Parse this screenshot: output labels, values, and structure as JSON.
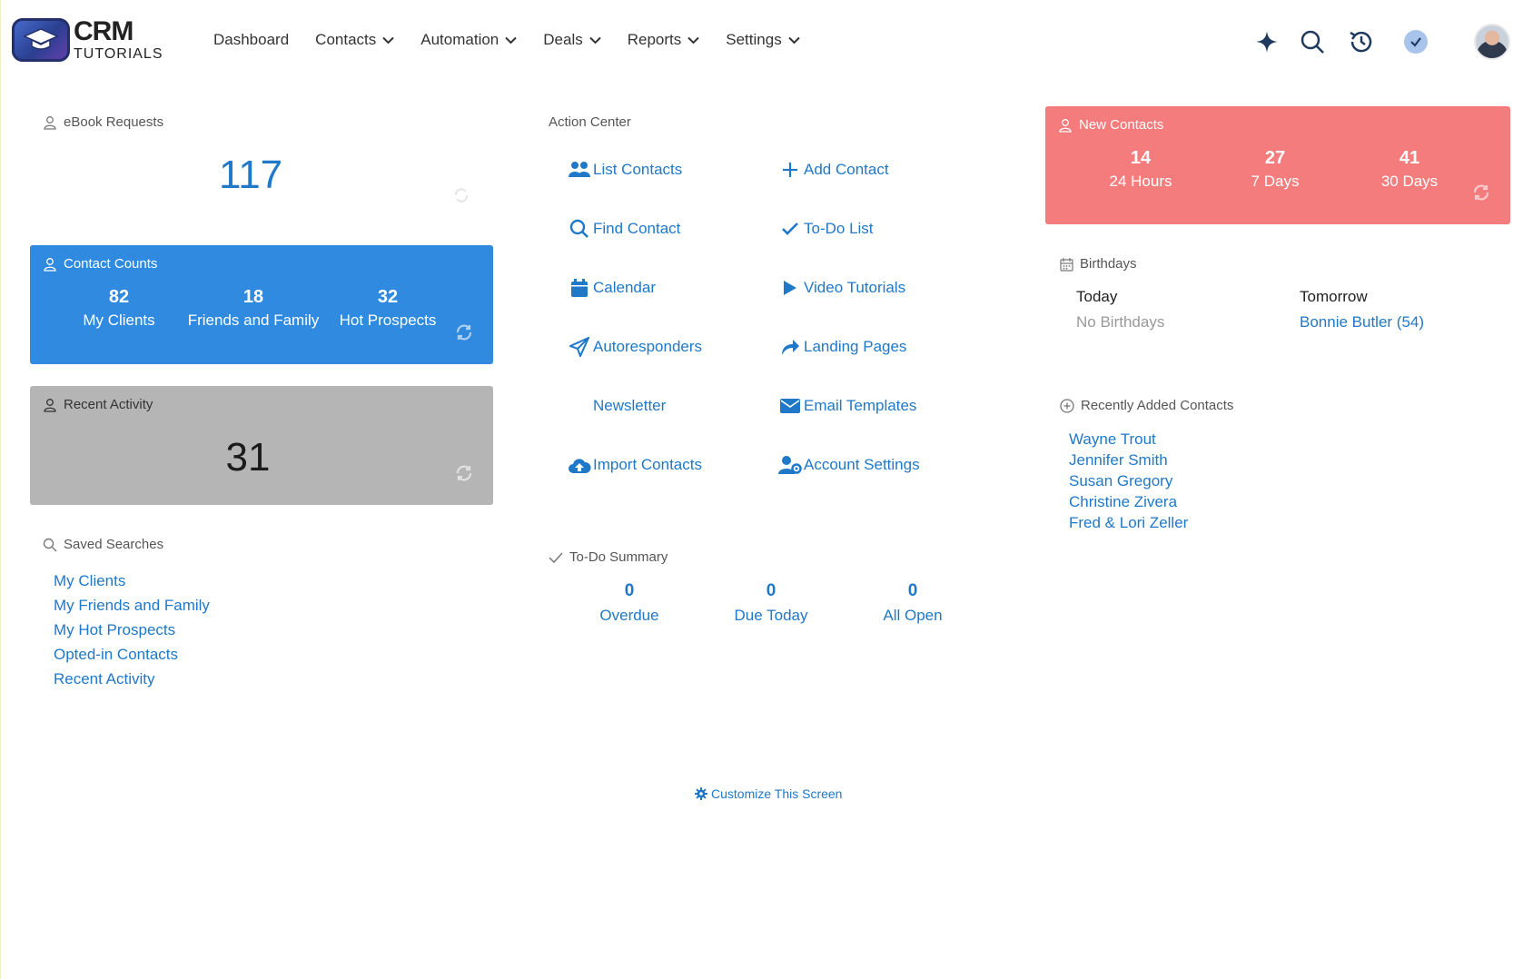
{
  "brand": {
    "line1": "CRM",
    "line2": "TUTORIALS"
  },
  "nav": {
    "items": [
      {
        "label": "Dashboard",
        "dropdown": false
      },
      {
        "label": "Contacts",
        "dropdown": true
      },
      {
        "label": "Automation",
        "dropdown": true
      },
      {
        "label": "Deals",
        "dropdown": true
      },
      {
        "label": "Reports",
        "dropdown": true
      },
      {
        "label": "Settings",
        "dropdown": true
      }
    ],
    "tools": [
      "sparkle-icon",
      "search-icon",
      "history-icon",
      "check-circle-icon"
    ]
  },
  "ebook": {
    "title": "eBook Requests",
    "count": "117"
  },
  "contact_counts": {
    "title": "Contact Counts",
    "stats": [
      {
        "num": "82",
        "label": "My Clients"
      },
      {
        "num": "18",
        "label": "Friends and Family"
      },
      {
        "num": "32",
        "label": "Hot Prospects"
      }
    ]
  },
  "recent_activity": {
    "title": "Recent Activity",
    "count": "31"
  },
  "saved_searches": {
    "title": "Saved Searches",
    "items": [
      "My Clients",
      "My Friends and Family",
      "My Hot Prospects",
      "Opted-in Contacts",
      "Recent Activity"
    ]
  },
  "action_center": {
    "title": "Action Center",
    "left": [
      {
        "label": "List Contacts",
        "icon": "users-icon"
      },
      {
        "label": "Find Contact",
        "icon": "search-icon"
      },
      {
        "label": "Calendar",
        "icon": "calendar-icon"
      },
      {
        "label": "Autoresponders",
        "icon": "paper-plane-icon"
      },
      {
        "label": "Newsletter",
        "icon": ""
      },
      {
        "label": "Import Contacts",
        "icon": "cloud-upload-icon"
      }
    ],
    "right": [
      {
        "label": "Add Contact",
        "icon": "plus-icon"
      },
      {
        "label": "To-Do List",
        "icon": "check-icon"
      },
      {
        "label": "Video Tutorials",
        "icon": "play-icon"
      },
      {
        "label": "Landing Pages",
        "icon": "share-arrow-icon"
      },
      {
        "label": "Email Templates",
        "icon": "envelope-icon"
      },
      {
        "label": "Account Settings",
        "icon": "user-gear-icon"
      }
    ]
  },
  "todo_summary": {
    "title": "To-Do Summary",
    "stats": [
      {
        "num": "0",
        "label": "Overdue"
      },
      {
        "num": "0",
        "label": "Due Today"
      },
      {
        "num": "0",
        "label": "All Open"
      }
    ]
  },
  "new_contacts": {
    "title": "New Contacts",
    "stats": [
      {
        "num": "14",
        "label": "24 Hours"
      },
      {
        "num": "27",
        "label": "7 Days"
      },
      {
        "num": "41",
        "label": "30 Days"
      }
    ]
  },
  "birthdays": {
    "title": "Birthdays",
    "today_label": "Today",
    "today_value": "No Birthdays",
    "tomorrow_label": "Tomorrow",
    "tomorrow_value": "Bonnie Butler (54)"
  },
  "recently_added": {
    "title": "Recently Added Contacts",
    "items": [
      "Wayne Trout",
      "Jennifer Smith",
      "Susan Gregory",
      "Christine Zivera",
      "Fred & Lori Zeller"
    ]
  },
  "customize_label": "Customize This Screen",
  "colors": {
    "link": "#1f78c8",
    "contact_counts_bg": "#2f8ae0",
    "recent_activity_bg": "#b5b5b5",
    "new_contacts_bg": "#f47c7c",
    "icon_dark": "#1e3a5f"
  }
}
